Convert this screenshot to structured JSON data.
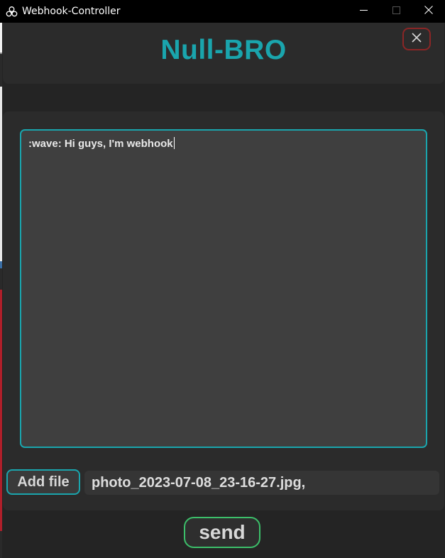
{
  "window": {
    "title": "Webhook-Controller",
    "app_icon": "biohazard-icon",
    "controls": [
      "minimize-icon",
      "maximize-icon",
      "close-icon"
    ]
  },
  "header": {
    "title": "Null-BRO",
    "close_icon": "close-icon"
  },
  "message": {
    "value": ":wave: Hi guys, I'm webhook"
  },
  "attachments": {
    "add_file_label": "Add file",
    "file_list": "photo_2023-07-08_23-16-27.jpg,"
  },
  "footer": {
    "send_label": "send"
  },
  "colors": {
    "accent": "#1aa5ad",
    "close_border": "#8b2626",
    "send_border": "#3cbf6a",
    "panel": "#2b2b2b",
    "background": "#242424",
    "textbox": "#3f3f3f"
  }
}
